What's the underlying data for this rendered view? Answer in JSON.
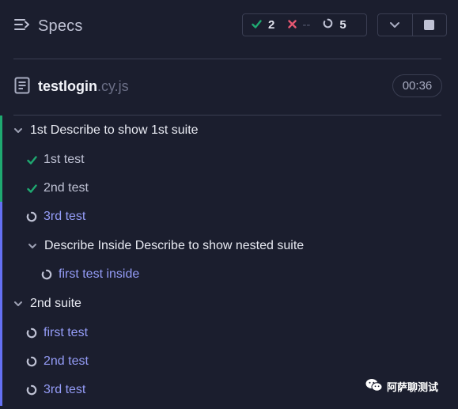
{
  "header": {
    "title": "Specs",
    "stats": {
      "passed": "2",
      "failed": "--",
      "pending": "5"
    }
  },
  "file": {
    "name_base": "testlogin",
    "name_ext": ".cy.js",
    "duration": "00:36"
  },
  "tree": [
    {
      "type": "suite",
      "label": "1st Describe to show 1st suite"
    },
    {
      "type": "passed",
      "label": "1st test"
    },
    {
      "type": "passed",
      "label": "2nd test"
    },
    {
      "type": "pending",
      "label": "3rd test"
    },
    {
      "type": "suite",
      "label": "Describe Inside Describe to show nested suite"
    },
    {
      "type": "pending",
      "label": "first test inside"
    },
    {
      "type": "suite",
      "label": "2nd suite"
    },
    {
      "type": "pending",
      "label": "first test"
    },
    {
      "type": "pending",
      "label": "2nd test"
    },
    {
      "type": "pending",
      "label": "3rd test"
    }
  ],
  "watermark": "阿萨聊测试",
  "colors": {
    "background": "#1b1e2e",
    "passed": "#1fa971",
    "failed": "#e45770",
    "pending": "#949cf7",
    "border": "#3a3e52"
  }
}
